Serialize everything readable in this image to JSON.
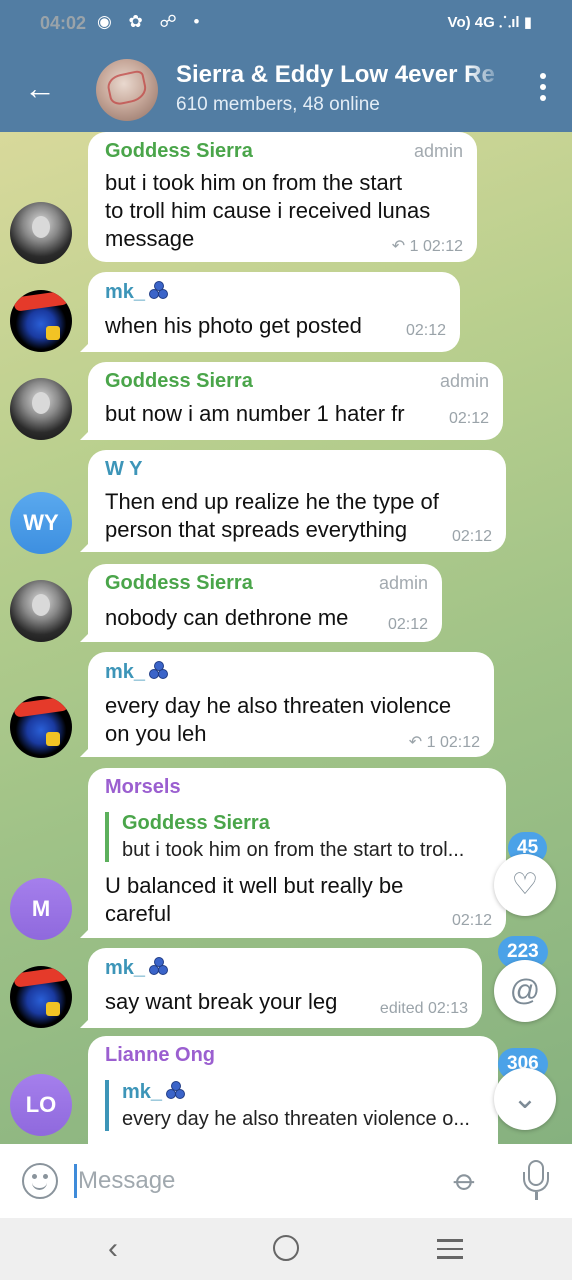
{
  "status_bar": {
    "time": "04:02",
    "left_icons": "◉ ✿ ☍  •",
    "right": "Vo) 4G ⸫ıl ▮"
  },
  "header": {
    "back_icon": "arrow-left",
    "title": "Sierra & Eddy Low 4ever Re",
    "subtitle": "610 members, 48 online",
    "menu_icon": "vertical-dots"
  },
  "colors": {
    "header": "#527da3",
    "sierra_name": "#4aa54a",
    "mk_name": "#3d95b8",
    "wy_name": "#3d95b8",
    "morsels_name": "#9b5fd0",
    "lianne_name": "#9b5fd0",
    "badge": "#4ba2e8"
  },
  "messages": [
    {
      "sender": "Goddess Sierra",
      "role": "admin",
      "lines": [
        "but i took him on from the start",
        "to troll him cause i received lunas",
        "message"
      ],
      "replies": "1",
      "time": "02:12"
    },
    {
      "sender": "mk_",
      "lines": [
        "when his photo get posted"
      ],
      "time": "02:12"
    },
    {
      "sender": "Goddess Sierra",
      "role": "admin",
      "lines": [
        "but now i am number 1 hater fr"
      ],
      "time": "02:12"
    },
    {
      "sender": "W Y",
      "avatar": "WY",
      "lines": [
        "Then end up realize he the type of",
        "person that spreads everything"
      ],
      "time": "02:12"
    },
    {
      "sender": "Goddess Sierra",
      "role": "admin",
      "lines": [
        "nobody can dethrone me"
      ],
      "time": "02:12"
    },
    {
      "sender": "mk_",
      "lines": [
        "every day he also threaten violence",
        "on you leh"
      ],
      "replies": "1",
      "time": "02:12"
    },
    {
      "sender": "Morsels",
      "avatar": "M",
      "quote_name": "Goddess Sierra",
      "quote_text": "but i took him on from the start to trol...",
      "lines": [
        "U balanced it well but really be",
        "careful"
      ],
      "time": "02:12"
    },
    {
      "sender": "mk_",
      "lines": [
        "say want break your leg"
      ],
      "time": "edited 02:13"
    },
    {
      "sender": "Lianne Ong",
      "avatar": "LO",
      "quote_name": "mk_",
      "quote_text": "every day he also threaten violence o..."
    }
  ],
  "floating": {
    "reactions_count": "45",
    "mentions_count": "223",
    "unread_count": "306"
  },
  "input": {
    "placeholder": "Message"
  }
}
